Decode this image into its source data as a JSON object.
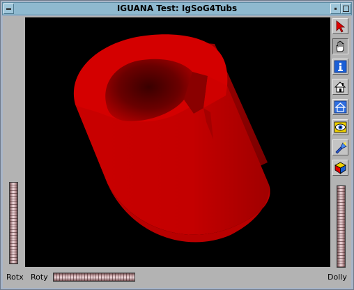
{
  "window": {
    "title": "IGUANA Test: IgSoG4Tubs"
  },
  "viewer": {
    "background": "#000000",
    "object_color": "#cc0000",
    "object": "tube segment"
  },
  "toolbar": {
    "buttons": [
      {
        "name": "pick-mode",
        "icon": "arrow-pointer-icon",
        "pressed": false
      },
      {
        "name": "view-mode",
        "icon": "hand-icon",
        "pressed": true
      },
      {
        "name": "help",
        "icon": "info-icon",
        "pressed": false
      },
      {
        "name": "home",
        "icon": "home-icon",
        "pressed": false
      },
      {
        "name": "set-home",
        "icon": "set-home-icon",
        "pressed": false
      },
      {
        "name": "view-all",
        "icon": "eye-icon",
        "pressed": false
      },
      {
        "name": "seek",
        "icon": "flashlight-icon",
        "pressed": false
      },
      {
        "name": "projection",
        "icon": "cube-icon",
        "pressed": false
      }
    ]
  },
  "thumbwheels": {
    "rotx_label": "Rotx",
    "roty_label": "Roty",
    "dolly_label": "Dolly"
  }
}
